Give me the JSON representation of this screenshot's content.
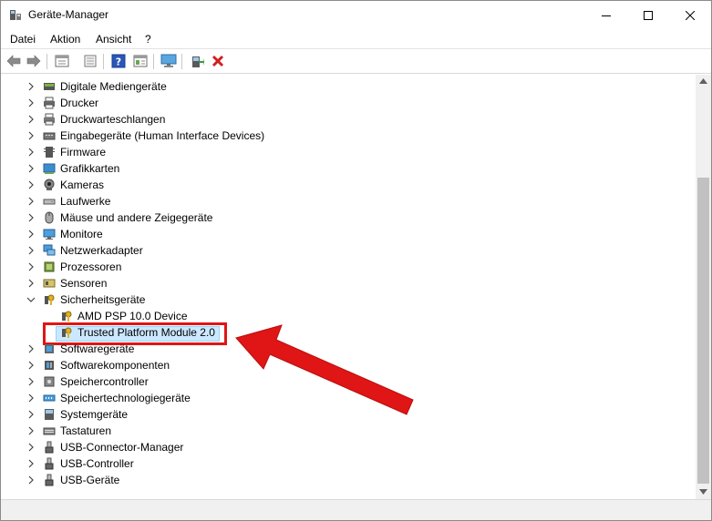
{
  "window": {
    "title": "Geräte-Manager",
    "icon": "device-manager-icon"
  },
  "menu": [
    {
      "label": "Datei"
    },
    {
      "label": "Aktion"
    },
    {
      "label": "Ansicht"
    },
    {
      "label": "?"
    }
  ],
  "toolbar": {
    "buttons": [
      "back-icon",
      "forward-icon",
      "properties-icon",
      "view-icon",
      "help-icon",
      "resource-view-icon",
      "computer-monitor-icon",
      "update-driver-icon",
      "uninstall-icon"
    ]
  },
  "tree": {
    "items": [
      {
        "label": "Digitale Mediengeräte",
        "icon": "media-device-icon",
        "state": "collapsed"
      },
      {
        "label": "Drucker",
        "icon": "printer-icon",
        "state": "collapsed"
      },
      {
        "label": "Druckwarteschlangen",
        "icon": "print-queue-icon",
        "state": "collapsed"
      },
      {
        "label": "Eingabegeräte (Human Interface Devices)",
        "icon": "hid-icon",
        "state": "collapsed"
      },
      {
        "label": "Firmware",
        "icon": "firmware-icon",
        "state": "collapsed"
      },
      {
        "label": "Grafikkarten",
        "icon": "display-adapter-icon",
        "state": "collapsed"
      },
      {
        "label": "Kameras",
        "icon": "camera-icon",
        "state": "collapsed"
      },
      {
        "label": "Laufwerke",
        "icon": "drive-icon",
        "state": "collapsed"
      },
      {
        "label": "Mäuse und andere Zeigegeräte",
        "icon": "mouse-icon",
        "state": "collapsed"
      },
      {
        "label": "Monitore",
        "icon": "monitor-icon",
        "state": "collapsed"
      },
      {
        "label": "Netzwerkadapter",
        "icon": "network-adapter-icon",
        "state": "collapsed"
      },
      {
        "label": "Prozessoren",
        "icon": "processor-icon",
        "state": "collapsed"
      },
      {
        "label": "Sensoren",
        "icon": "sensor-icon",
        "state": "collapsed"
      },
      {
        "label": "Sicherheitsgeräte",
        "icon": "security-device-icon",
        "state": "expanded"
      },
      {
        "label": "AMD PSP 10.0 Device",
        "icon": "security-device-icon",
        "state": "child"
      },
      {
        "label": "Trusted Platform Module 2.0",
        "icon": "security-device-icon",
        "state": "child-selected"
      },
      {
        "label": "Softwaregeräte",
        "icon": "software-device-icon",
        "state": "collapsed"
      },
      {
        "label": "Softwarekomponenten",
        "icon": "software-component-icon",
        "state": "collapsed"
      },
      {
        "label": "Speichercontroller",
        "icon": "storage-controller-icon",
        "state": "collapsed"
      },
      {
        "label": "Speichertechnologiegeräte",
        "icon": "memory-technology-icon",
        "state": "collapsed"
      },
      {
        "label": "Systemgeräte",
        "icon": "system-device-icon",
        "state": "collapsed"
      },
      {
        "label": "Tastaturen",
        "icon": "keyboard-icon",
        "state": "collapsed"
      },
      {
        "label": "USB-Connector-Manager",
        "icon": "usb-icon",
        "state": "collapsed"
      },
      {
        "label": "USB-Controller",
        "icon": "usb-icon",
        "state": "collapsed"
      },
      {
        "label": "USB-Geräte",
        "icon": "usb-icon",
        "state": "collapsed"
      }
    ]
  },
  "colors": {
    "highlight_border": "#e01515",
    "arrow": "#e01515",
    "selection": "#cce8ff"
  }
}
